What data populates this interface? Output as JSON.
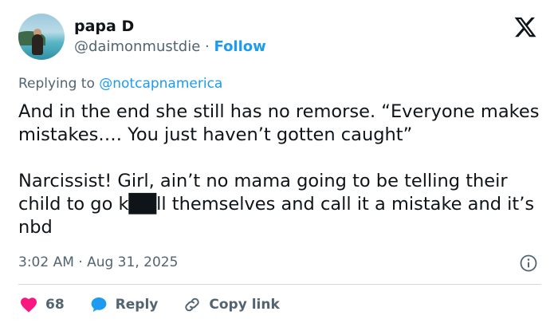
{
  "user": {
    "display_name": "papa D",
    "handle": "@daimonmustdie",
    "separator": "·",
    "follow_label": "Follow"
  },
  "reply": {
    "prefix": "Replying to",
    "mention": "@notcapnamerica"
  },
  "tweet": {
    "text": "And in the end she still has no remorse. “Everyone makes mistakes…. You just haven’t gotten caught”\n\nNarcissist! Girl, ain’t no mama going to be telling their child to go k██ll themselves and call it a mistake and it’s nbd"
  },
  "meta": {
    "timestamp": "3:02 AM · Aug 31, 2025"
  },
  "actions": {
    "like_count": "68",
    "reply_label": "Reply",
    "copy_link_label": "Copy link"
  },
  "icons": {
    "brand": "x-logo-icon",
    "info": "info-icon",
    "like": "heart-icon",
    "reply": "speech-bubble-icon",
    "copy": "link-icon"
  },
  "colors": {
    "accent": "#1d9bf0",
    "like": "#f91880",
    "secondary_text": "#536471",
    "primary_text": "#0f1419"
  }
}
